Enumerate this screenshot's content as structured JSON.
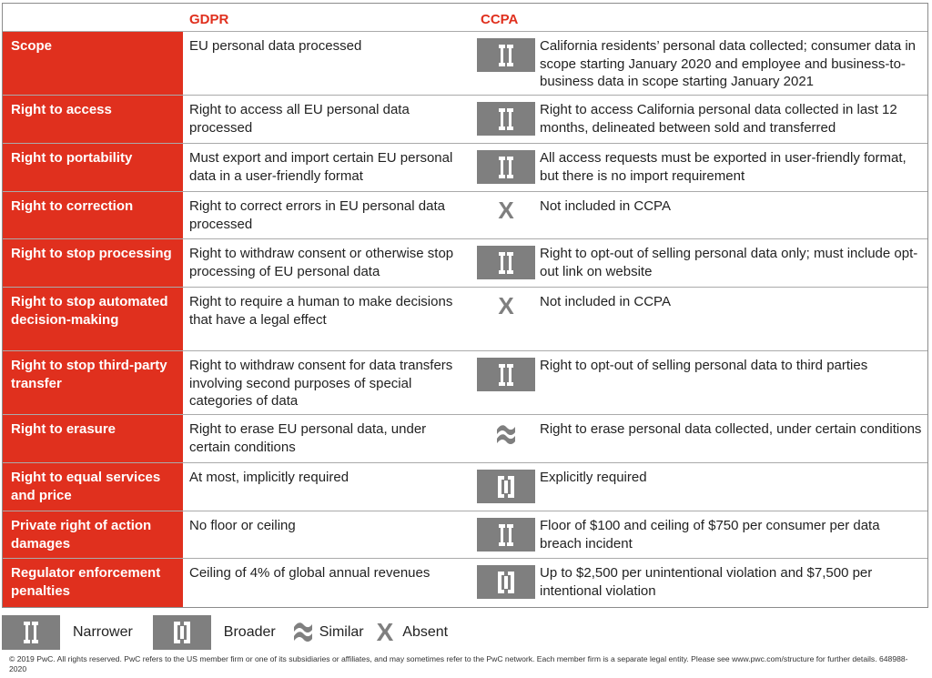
{
  "header": {
    "col_gdpr": "GDPR",
    "col_ccpa": "CCPA"
  },
  "colors": {
    "accent_red": "#e0301e",
    "icon_gray": "#7f7f7f"
  },
  "rows": [
    {
      "label": "Scope",
      "gdpr": "EU personal data processed",
      "icon": "narrower",
      "ccpa": "California residents’ personal data collected; consumer data in scope starting January 2020 and employee and business-to-business data in scope starting January 2021"
    },
    {
      "label": "Right to access",
      "gdpr": "Right to access all EU personal data processed",
      "icon": "narrower",
      "ccpa": "Right to access California personal data collected in last 12 months, delineated between sold and transferred"
    },
    {
      "label": "Right to portability",
      "gdpr": "Must export and import certain EU personal data in a user-friendly format",
      "icon": "narrower",
      "ccpa": "All access requests must be exported in user-friendly format, but there is no import requirement"
    },
    {
      "label": "Right to correction",
      "gdpr": "Right to correct errors in EU personal data processed",
      "icon": "absent",
      "ccpa": "Not included in CCPA"
    },
    {
      "label": "Right to stop processing",
      "gdpr": "Right to withdraw consent or otherwise stop processing of EU personal data",
      "icon": "narrower",
      "ccpa": "Right to opt-out of selling personal data only; must include opt-out link on website"
    },
    {
      "label": "Right to stop automated decision-making",
      "gdpr": "Right to require a human to make decisions that have a legal effect",
      "icon": "absent",
      "ccpa": "Not included in CCPA"
    },
    {
      "label": "Right to stop third-party transfer",
      "gdpr": "Right to withdraw consent for data transfers involving second purposes of special categories of data",
      "icon": "narrower",
      "ccpa": "Right to opt-out of selling personal data to third parties"
    },
    {
      "label": "Right to erasure",
      "gdpr": "Right to erase EU personal data, under certain conditions",
      "icon": "similar",
      "ccpa": "Right to erase personal data collected, under certain conditions"
    },
    {
      "label": "Right to equal services and price",
      "gdpr": "At most, implicitly required",
      "icon": "broader",
      "ccpa": "Explicitly required"
    },
    {
      "label": "Private right of action damages",
      "gdpr": "No floor or ceiling",
      "icon": "narrower",
      "ccpa": "Floor of $100 and ceiling of $750 per consumer per data breach incident"
    },
    {
      "label": "Regulator enforcement penalties",
      "gdpr": "Ceiling of 4% of global annual revenues",
      "icon": "broader",
      "ccpa": "Up to $2,500 per unintentional violation and $7,500 per intentional violation"
    }
  ],
  "legend": {
    "narrower": "Narrower",
    "broader": "Broader",
    "similar": "Similar",
    "absent": "Absent"
  },
  "footer": "© 2019 PwC. All rights reserved. PwC refers to the US member firm or one of its subsidiaries or affiliates, and may sometimes refer to the PwC network. Each member firm is a separate legal entity. Please see www.pwc.com/structure for further details. 648988-2020"
}
